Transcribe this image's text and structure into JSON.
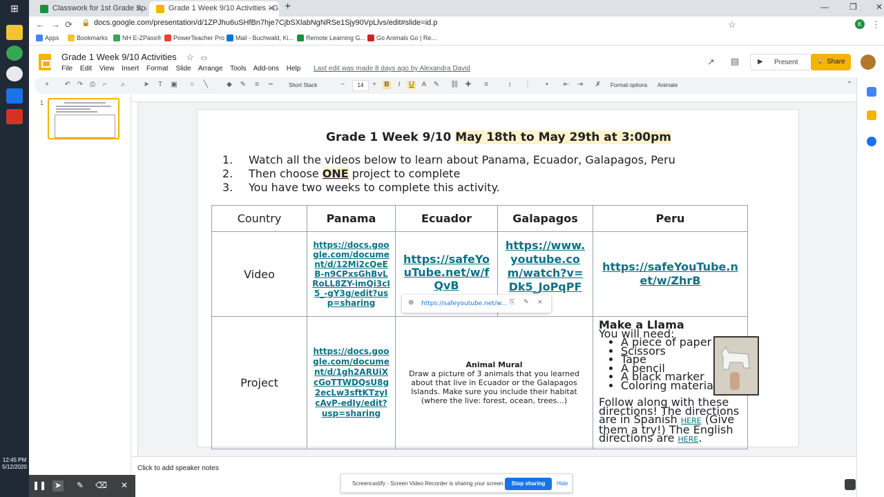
{
  "taskbar": {
    "time": "12:45 PM",
    "date": "5/12/2020"
  },
  "browser": {
    "tabs": [
      {
        "label": "Classwork for 1st Grade Spanish",
        "color": "#1e8e3e"
      },
      {
        "label": "Grade 1 Week 9/10 Activities - G",
        "color": "#f4b400"
      }
    ],
    "url": "docs.google.com/presentation/d/1ZPJhu6uSHfBn7hje7CjbSXlabNgNRSe1Sjy90VpLlvs/edit#slide=id.p",
    "bookmarks": [
      {
        "label": "Apps",
        "color": "#4285f4"
      },
      {
        "label": "Bookmarks",
        "color": "#5f6368"
      },
      {
        "label": "NH E-ZPass®",
        "color": "#34a853"
      },
      {
        "label": "PowerTeacher Pro",
        "color": "#ea4335"
      },
      {
        "label": "Mail - Buchwald, Ki...",
        "color": "#0078d4"
      },
      {
        "label": "Remote Learning G...",
        "color": "#1e8e3e"
      },
      {
        "label": "Go Animals Go | Re...",
        "color": "#c62828"
      }
    ]
  },
  "docs": {
    "title": "Grade 1 Week 9/10 Activities",
    "menus": [
      "File",
      "Edit",
      "View",
      "Insert",
      "Format",
      "Slide",
      "Arrange",
      "Tools",
      "Add-ons",
      "Help"
    ],
    "last_edit": "Last edit was made 8 days ago by Alexandra David",
    "present_label": "Present",
    "share_label": "Share"
  },
  "toolbar": {
    "font_name": "Short Stack",
    "font_size": "14",
    "format_options": "Format options",
    "animate": "Animate"
  },
  "filmstrip": {
    "slide_number": "1"
  },
  "slide": {
    "heading_main": "Grade 1 Week 9/10",
    "heading_dates": "May 18th to May 29th at 3:00pm",
    "steps": [
      {
        "num": "1.",
        "text": "Watch all the videos below to learn about Panama, Ecuador, Galapagos, Peru"
      },
      {
        "num": "2.",
        "pre": "Then choose",
        "emph": "ONE",
        "post": "project to complete"
      },
      {
        "num": "3.",
        "text": "You have two weeks to complete this activity."
      }
    ],
    "table": {
      "headers": [
        "Country",
        "Panama",
        "Ecuador",
        "Galapagos",
        "Peru"
      ],
      "video_label": "Video",
      "project_label": "Project",
      "video_links": [
        "https://docs.google.com/document/d/12Mi2cQeEB-n9CPxsGhBvLRoLL8ZY-imQi3cI5_-gY3g/edit?usp=sharing",
        "https://safeYouTube.net/w/fQvB",
        "https://www.youtube.com/watch?v=Dk5_JoPqPF",
        "https://safeYouTube.net/w/ZhrB"
      ],
      "project_panama_link": "https://docs.google.com/document/d/1gh2ARUiXcGoTTWDQsU8g2ecLw3sftKTzyIcAvP-edIy/edit?usp=sharing",
      "mural_title": "Animal Mural",
      "mural_body": "Draw a picture of 3 animals that you learned about that live in Ecuador or the Galapagos Islands. Make sure you include their habitat (where the live: forest, ocean, trees...)",
      "llama_title": "Make a Llama",
      "llama_need": "You will need:",
      "llama_items": [
        "A piece of paper",
        "Scissors",
        "Tape",
        "A pencil",
        "A black marker",
        "Coloring materials"
      ],
      "llama_follow": "Follow along with these directions! The directions are in Spanish",
      "llama_here": "HERE",
      "llama_try": "(Give them a try!)",
      "llama_english": "The English directions are",
      "llama_period": "."
    },
    "link_popup": "https://safeyoutube.net/w..."
  },
  "notes": {
    "placeholder": "Click to add speaker notes"
  },
  "screencastify": {
    "message": "Screencastify - Screen Video Recorder is sharing your screen.",
    "stop_label": "Stop sharing",
    "hide_label": "Hide"
  }
}
